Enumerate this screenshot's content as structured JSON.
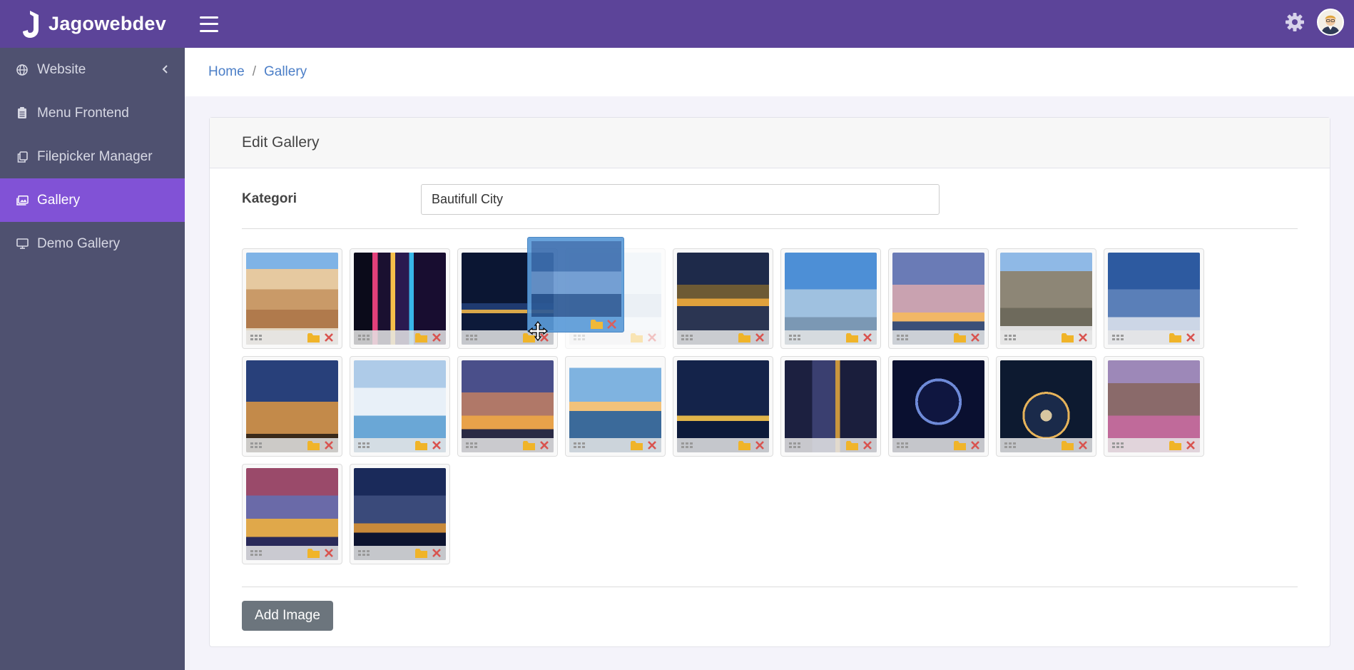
{
  "brand": {
    "name": "Jagowebdev"
  },
  "sidebar": {
    "items": [
      {
        "label": "Website",
        "icon": "globe-icon",
        "has_submenu": true,
        "active": false
      },
      {
        "label": "Menu Frontend",
        "icon": "clipboard-icon",
        "has_submenu": false,
        "active": false
      },
      {
        "label": "Filepicker Manager",
        "icon": "copy-icon",
        "has_submenu": false,
        "active": false
      },
      {
        "label": "Gallery",
        "icon": "images-icon",
        "has_submenu": false,
        "active": true
      },
      {
        "label": "Demo Gallery",
        "icon": "monitor-icon",
        "has_submenu": false,
        "active": false
      }
    ]
  },
  "breadcrumb": {
    "home": "Home",
    "separator": "/",
    "current": "Gallery"
  },
  "card": {
    "title": "Edit Gallery"
  },
  "form": {
    "kategori_label": "Kategori",
    "kategori_value": "Bautifull City"
  },
  "gallery": {
    "images": [
      {
        "scene": "hillside-town"
      },
      {
        "scene": "neon-street-night"
      },
      {
        "scene": "city-waterfront-night"
      },
      {
        "scene": "snowy-canal-placeholder",
        "dragging": true
      },
      {
        "scene": "chain-bridge-night"
      },
      {
        "scene": "dubai-skyline"
      },
      {
        "scene": "burj-al-arab-sunset"
      },
      {
        "scene": "cliff-town"
      },
      {
        "scene": "galata-tower"
      },
      {
        "scene": "hagia-sophia"
      },
      {
        "scene": "arts-sciences-valencia"
      },
      {
        "scene": "tower-bridge-sunset"
      },
      {
        "scene": "harbor-sunrise"
      },
      {
        "scene": "toronto-night"
      },
      {
        "scene": "amsterdam-canal-night"
      },
      {
        "scene": "ferris-wheel-night"
      },
      {
        "scene": "highway-interchange-night"
      },
      {
        "scene": "venice-canal-dusk"
      },
      {
        "scene": "prague-castle"
      },
      {
        "scene": "petronas-towers"
      }
    ]
  },
  "actions": {
    "add_image": "Add Image"
  },
  "colors": {
    "header": "#5c4499",
    "sidebar": "#4f5170",
    "sidebar_active": "#8152d6",
    "link": "#4b7ec7",
    "folder": "#f0b429",
    "delete": "#d9534f",
    "button": "#6c757d"
  }
}
